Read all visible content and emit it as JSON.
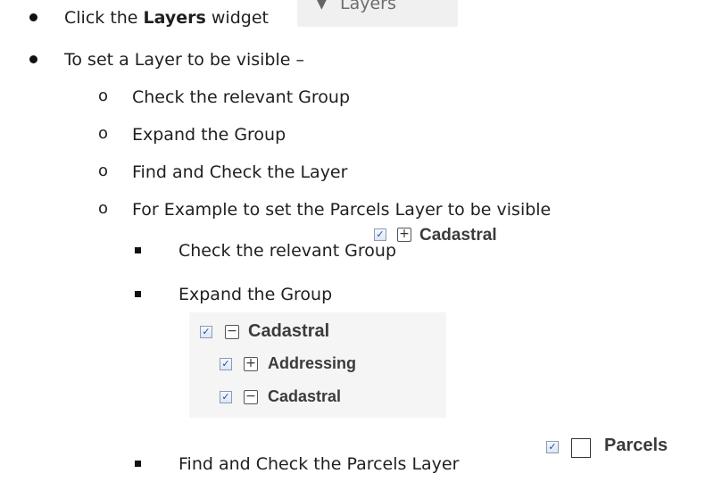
{
  "steps": {
    "click_prefix": "Click the ",
    "click_bold": "Layers",
    "click_suffix": " widget",
    "widget_label": "Layers",
    "set_visible": "To set a Layer to be visible –",
    "sub": [
      "Check the relevant Group",
      "Expand the Group",
      "Find and Check the Layer",
      "For Example to set the Parcels Layer to be visible"
    ],
    "example": {
      "check_group": "Check the relevant Group",
      "expand_group": "Expand the Group",
      "find_parcels": "Find and Check the Parcels Layer"
    }
  },
  "tree": {
    "group_collapsed": "Cadastral",
    "group_expanded": "Cadastral",
    "child_addressing": "Addressing",
    "child_cadastral": "Cadastral",
    "layer_parcels": "Parcels"
  },
  "icons": {
    "check": "checkbox-checked-icon",
    "plus": "expand-plus-icon",
    "minus": "collapse-minus-icon",
    "empty": "checkbox-empty-icon",
    "arrow": "triangle-down-icon"
  }
}
